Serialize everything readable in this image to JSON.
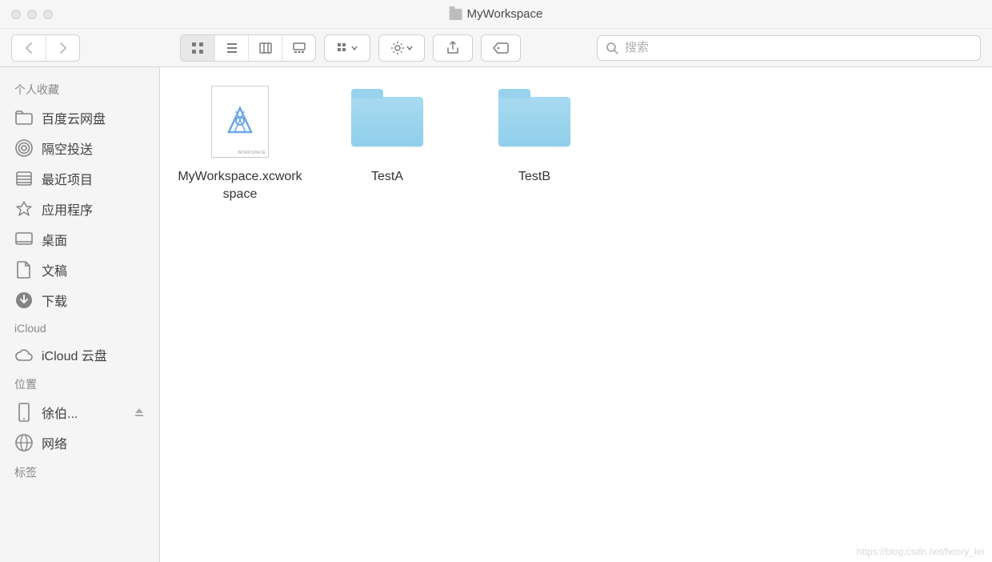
{
  "window": {
    "title": "MyWorkspace"
  },
  "search": {
    "placeholder": "搜索"
  },
  "sidebar": {
    "sections": {
      "favorites": {
        "title": "个人收藏",
        "items": [
          {
            "label": "百度云网盘",
            "icon": "folder"
          },
          {
            "label": "隔空投送",
            "icon": "airdrop"
          },
          {
            "label": "最近项目",
            "icon": "recents"
          },
          {
            "label": "应用程序",
            "icon": "applications"
          },
          {
            "label": "桌面",
            "icon": "desktop"
          },
          {
            "label": "文稿",
            "icon": "documents"
          },
          {
            "label": "下载",
            "icon": "downloads"
          }
        ]
      },
      "icloud": {
        "title": "iCloud",
        "items": [
          {
            "label": "iCloud 云盘",
            "icon": "cloud"
          }
        ]
      },
      "locations": {
        "title": "位置",
        "items": [
          {
            "label": "徐伯...",
            "icon": "device",
            "eject": true
          },
          {
            "label": "网络",
            "icon": "network"
          }
        ]
      },
      "tags": {
        "title": "标签",
        "items": []
      }
    }
  },
  "content": {
    "items": [
      {
        "name": "MyWorkspace.xcworkspace",
        "type": "xcworkspace"
      },
      {
        "name": "TestA",
        "type": "folder"
      },
      {
        "name": "TestB",
        "type": "folder"
      }
    ]
  },
  "watermark": "https://blog.csdn.net/henry_lei"
}
